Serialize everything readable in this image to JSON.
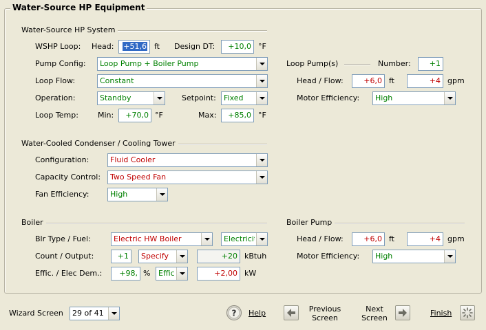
{
  "title": "Water-Source HP Equipment",
  "wshp_system": {
    "section": "Water-Source HP System",
    "loop_label": "WSHP Loop:",
    "head_label": "Head:",
    "head_value": "+51,6",
    "head_unit": "ft",
    "design_dt_label": "Design DT:",
    "design_dt_value": "+10,0",
    "design_dt_unit": "°F",
    "pump_config_label": "Pump Config:",
    "pump_config_value": "Loop Pump + Boiler Pump",
    "loop_flow_label": "Loop Flow:",
    "loop_flow_value": "Constant",
    "operation_label": "Operation:",
    "operation_value": "Standby",
    "setpoint_label": "Setpoint:",
    "setpoint_value": "Fixed",
    "loop_temp_label": "Loop Temp:",
    "min_label": "Min:",
    "min_value": "+70,0",
    "min_unit": "°F",
    "max_label": "Max:",
    "max_value": "+85,0",
    "max_unit": "°F"
  },
  "loop_pumps": {
    "section": "Loop Pump(s)",
    "number_label": "Number:",
    "number_value": "+1",
    "head_flow_label": "Head / Flow:",
    "head_value": "+6,0",
    "head_unit": "ft",
    "flow_value": "+4",
    "flow_unit": "gpm",
    "motor_eff_label": "Motor Efficiency:",
    "motor_eff_value": "High"
  },
  "condenser": {
    "section": "Water-Cooled Condenser / Cooling Tower",
    "configuration_label": "Configuration:",
    "configuration_value": "Fluid Cooler",
    "capacity_label": "Capacity Control:",
    "capacity_value": "Two Speed Fan",
    "fan_eff_label": "Fan Efficiency:",
    "fan_eff_value": "High"
  },
  "boiler": {
    "section": "Boiler",
    "type_fuel_label": "Blr Type / Fuel:",
    "type_value": "Electric HW Boiler",
    "fuel_value": "Electricit",
    "count_output_label": "Count / Output:",
    "count_value": "+1",
    "output_mode_value": "Specify",
    "output_value": "+20",
    "output_unit": "kBtuh",
    "effic_label": "Effic. / Elec Dem.:",
    "effic_value": "+98,",
    "effic_unit": "%",
    "effic_mode_value": "Effici",
    "elec_dem_value": "+2,00",
    "elec_dem_unit": "kW"
  },
  "boiler_pump": {
    "section": "Boiler Pump",
    "head_flow_label": "Head / Flow:",
    "head_value": "+6,0",
    "head_unit": "ft",
    "flow_value": "+4",
    "flow_unit": "gpm",
    "motor_eff_label": "Motor Efficiency:",
    "motor_eff_value": "High"
  },
  "footer": {
    "wizard_label": "Wizard Screen",
    "wizard_value": "29 of 41",
    "help_label": "Help",
    "previous_line1": "Previous",
    "previous_line2": "Screen",
    "next_line1": "Next",
    "next_line2": "Screen",
    "finish_label": "Finish"
  }
}
